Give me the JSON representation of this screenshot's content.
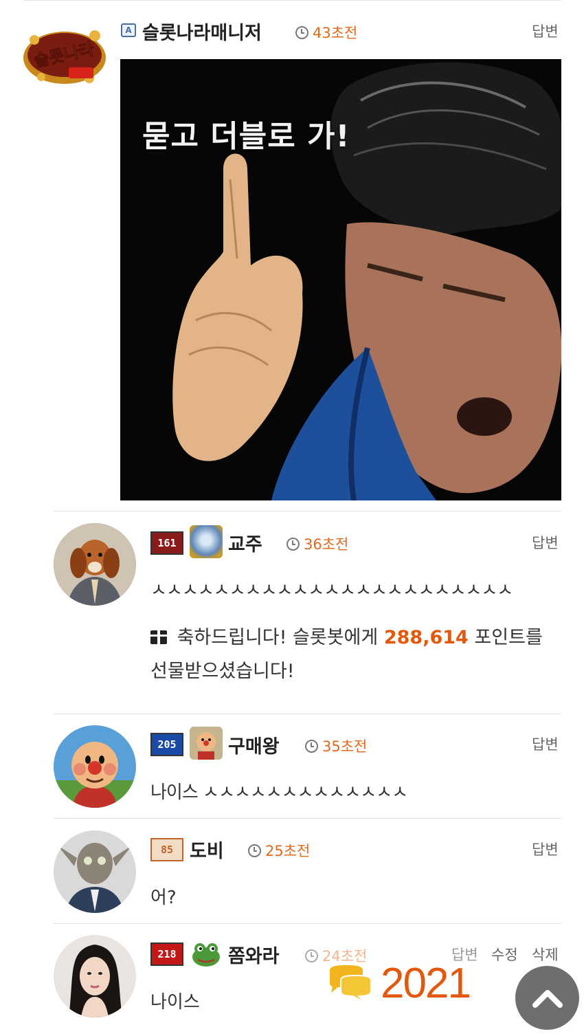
{
  "post": {
    "author": "슬롯나라매니저",
    "author_badge": "A",
    "time": "43초전",
    "reply_label": "답변",
    "image_caption": "묻고 더블로 가!",
    "logo_text": "슬롯나라"
  },
  "comments": [
    {
      "name": "교주",
      "level": "161",
      "time": "36초전",
      "reply_label": "답변",
      "text": "ㅅㅅㅅㅅㅅㅅㅅㅅㅅㅅㅅㅅㅅㅅㅅㅅㅅㅅㅅㅅㅅㅅㅅ",
      "gift_pre": "축하드립니다! 슬롯봇에게",
      "gift_points": "288,614",
      "gift_post": "포인트를 선물받으셨습니다!"
    },
    {
      "name": "구매왕",
      "level": "205",
      "time": "35초전",
      "reply_label": "답변",
      "text": "나이스 ㅅㅅㅅㅅㅅㅅㅅㅅㅅㅅㅅㅅㅅ"
    },
    {
      "name": "도비",
      "level": "85",
      "time": "25초전",
      "reply_label": "답변",
      "text": "어?"
    },
    {
      "name": "쫌와라",
      "level": "218",
      "time": "24초전",
      "reply_label": "답변",
      "edit_label": "수정",
      "delete_label": "삭제",
      "text": "나이스"
    }
  ],
  "comment_count": "2021",
  "colors": {
    "accent": "#e3580c",
    "time": "#e36a1c",
    "top_button": "#6e6e6e"
  }
}
